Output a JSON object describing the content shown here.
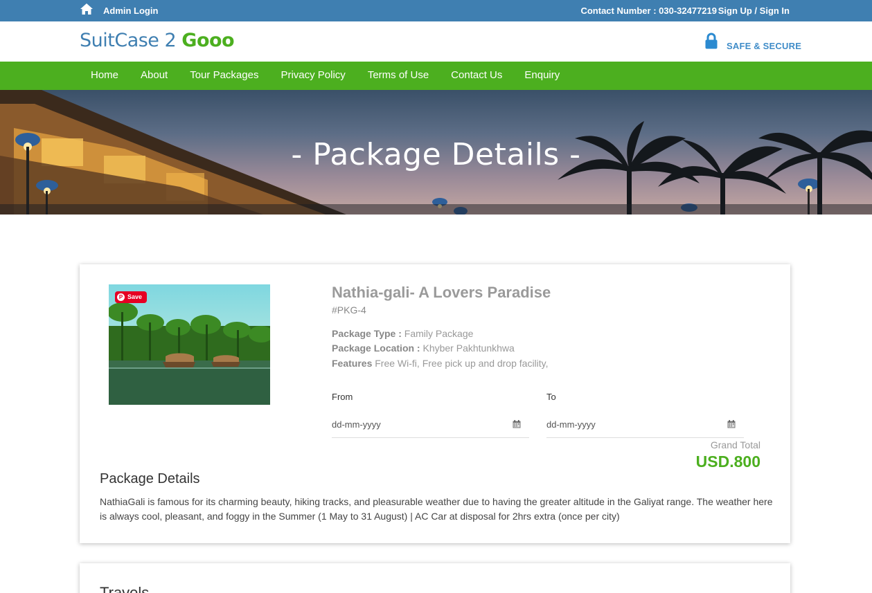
{
  "topbar": {
    "admin_login": "Admin Login",
    "contact": "Contact Number : 030-32477219",
    "sign_in": "Sign Up / Sign In"
  },
  "header": {
    "logo_part1": "SuitCase 2",
    "logo_part2": "Gooo",
    "safe_label": "SAFE & SECURE"
  },
  "nav": {
    "items": [
      "Home",
      "About",
      "Tour Packages",
      "Privacy Policy",
      "Terms of Use",
      "Contact Us",
      "Enquiry"
    ]
  },
  "hero": {
    "title": "- Package Details -"
  },
  "package": {
    "save_label": "Save",
    "title": "Nathia-gali- A Lovers Paradise",
    "id": "#PKG-4",
    "type_label": "Package Type :",
    "type_value": "Family Package",
    "location_label": "Package Location :",
    "location_value": "Khyber Pakhtunkhwa",
    "features_label": "Features",
    "features_value": "Free Wi-fi, Free pick up and drop facility,",
    "from_label": "From",
    "to_label": "To",
    "from_placeholder": "dd-mm-yyyy",
    "to_placeholder": "dd-mm-yyyy",
    "grand_total_label": "Grand Total",
    "grand_total_value": "USD.800",
    "details_title": "Package Details",
    "details_text": "NathiaGali is famous for its charming beauty, hiking tracks, and pleasurable weather due to having the greater altitude in the Galiyat range. The weather here is always cool, pleasant, and foggy in the Summer (1 May to 31 August) | AC Car at disposal for 2hrs extra (once per city)"
  },
  "travels": {
    "title": "Travels"
  },
  "colors": {
    "topbar": "#3f7fb1",
    "nav": "#4caf1f",
    "accent_green": "#4caf1f",
    "accent_blue": "#3f7fb1"
  },
  "icons": [
    "home-icon",
    "lock-icon",
    "calendar-icon",
    "pinterest-icon"
  ]
}
